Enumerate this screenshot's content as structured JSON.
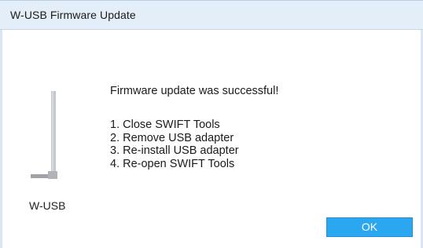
{
  "window": {
    "title": "W-USB Firmware Update"
  },
  "device": {
    "label": "W-USB",
    "icon": "usb-adapter-icon"
  },
  "dialog": {
    "message": "Firmware update was successful!",
    "steps": [
      "1. Close SWIFT Tools",
      "2. Remove USB adapter",
      "3. Re-install USB adapter",
      "4. Re-open SWIFT Tools"
    ]
  },
  "buttons": {
    "ok_label": "OK"
  },
  "colors": {
    "titlebar": "#e3eef9",
    "accent_button": "#2ba6f0",
    "icon_gray": "#b8bcc0"
  }
}
